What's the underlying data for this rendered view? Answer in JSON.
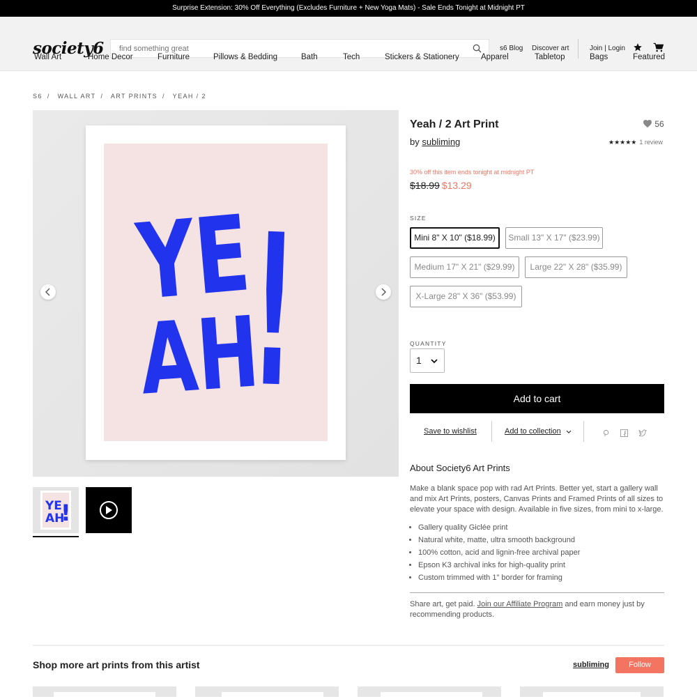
{
  "promo": {
    "text": "Surprise Extension: 30% Off Everything (Excludes Furniture + New Yoga Mats) - Sale Ends Tonight at Midnight PT"
  },
  "header": {
    "logo": "society6",
    "search_placeholder": "find something great",
    "blog": "s6 Blog",
    "discover": "Discover art",
    "join": "Join | Login"
  },
  "nav": [
    "Wall Art",
    "Home Decor",
    "Furniture",
    "Pillows & Bedding",
    "Bath",
    "Tech",
    "Stickers & Stationery",
    "Apparel",
    "Tabletop",
    "Bags",
    "Featured"
  ],
  "breadcrumb": [
    "S6",
    "WALL ART",
    "ART PRINTS",
    "YEAH / 2"
  ],
  "product": {
    "artwork_text": [
      "YE",
      "AH",
      "!"
    ],
    "title": "Yeah / 2 Art Print",
    "by_label": "by",
    "artist": "subliming",
    "likes": "56",
    "stars": "★★★★★",
    "reviews": "1 review",
    "sale_note": "30% off this item ends tonight at midnight PT",
    "old_price": "$18.99",
    "new_price": "$13.29",
    "size_label": "SIZE",
    "sizes": [
      "Mini 8\" X 10\" ($18.99)",
      "Small 13\" X 17\" ($23.99)",
      "Medium 17\" X 21\" ($29.99)",
      "Large 22\" X 28\" ($35.99)",
      "X-Large 28\" X 36\" ($53.99)"
    ],
    "quantity_label": "QUANTITY",
    "quantity": "1",
    "add_to_cart": "Add to cart",
    "save_wishlist": "Save to wishlist",
    "add_collection": "Add to collection"
  },
  "about": {
    "heading": "About Society6 Art Prints",
    "text": "Make a blank space pop with rad Art Prints. Better yet, start a gallery wall and mix Art Prints, posters, Canvas Prints and Framed Prints of all sizes to elevate your space with design. Available in five sizes, from mini to x-large.",
    "bullets": [
      "Gallery quality Giclée print",
      "Natural white, matte, ultra smooth background",
      "100% cotton, acid and lignin-free archival paper",
      "Epson K3 archival inks for high-quality print",
      "Custom trimmed with 1\" border for framing"
    ],
    "affiliate_pre": "Share art, get paid. ",
    "affiliate_link": "Join our Affiliate Program",
    "affiliate_post": " and earn money just by recommending products."
  },
  "more": {
    "heading": "Shop more art prints from this artist",
    "artist": "subliming",
    "follow": "Follow"
  },
  "colors": {
    "accent": "#f37460",
    "art_blue": "#2233ee",
    "art_pink": "#f5e2e2"
  }
}
